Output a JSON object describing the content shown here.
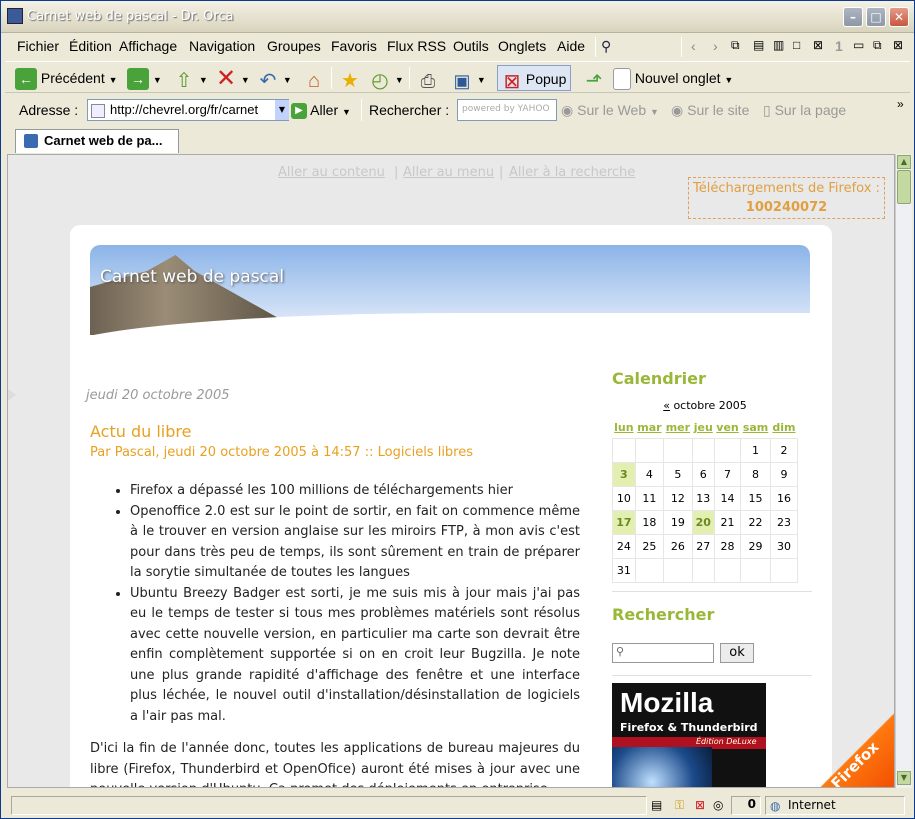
{
  "window": {
    "title": "Carnet web de pascal - Dr. Orca"
  },
  "menu": [
    "Fichier",
    "Édition",
    "Affichage",
    "Navigation",
    "Groupes",
    "Favoris",
    "Flux RSS",
    "Outils",
    "Onglets",
    "Aide"
  ],
  "tab_count": "1",
  "toolbar": {
    "back": "Précédent",
    "popup": "Popup",
    "new_tab": "Nouvel onglet"
  },
  "address": {
    "label": "Adresse :",
    "url": "http://chevrel.org/fr/carnet",
    "go": "Aller"
  },
  "search": {
    "label": "Rechercher :",
    "powered": "powered by YAHOO",
    "web": "Sur le Web",
    "site": "Sur le site",
    "page": "Sur la page"
  },
  "tab": {
    "title": "Carnet web de pa..."
  },
  "page": {
    "skip": [
      "Aller au contenu",
      "Aller au menu",
      "Aller à la recherche"
    ],
    "seps": [
      "|",
      "|"
    ],
    "downloads_label": "Téléchargements de Firefox :",
    "downloads_count": "100240072",
    "blog_title": "Carnet web de pascal",
    "date": "jeudi 20 octobre 2005",
    "post_title": "Actu du libre",
    "post_meta": "Par Pascal, jeudi 20 octobre 2005 à 14:57 :: Logiciels libres",
    "items": [
      "Firefox a dépassé les 100 millions de téléchargements hier",
      "Openoffice 2.0 est sur le point de sortir, en fait on commence même à le trouver en version anglaise sur les miroirs FTP, à mon avis c'est pour dans très peu de temps, ils sont sûrement en train de préparer la sorytie simultanée de toutes les langues",
      "Ubuntu Breezy Badger est sorti, je me suis mis à jour mais j'ai pas eu le temps de tester si tous mes problèmes matériels sont résolus avec cette nouvelle version, en particulier ma carte son devrait être enfin complètement supportée si on en croit leur Bugzilla. Je note une plus grande rapidité d'affichage des fenêtre et une interface plus léchée, le nouvel outil d'installation/désinstallation de logiciels a l'air pas mal."
    ],
    "paragraph": "D'ici la fin de l'année donc, toutes les applications de bureau majeures du libre (Firefox, Thunderbird et OpenOfice) auront été mises à jour avec une nouvelle version d'Ubuntu. Ça promet des déploiements en entreprise",
    "calendar_title": "Calendrier",
    "calendar_prev": "«",
    "calendar_month": "octobre 2005",
    "weekdays": [
      "lun",
      "mar",
      "mer",
      "jeu",
      "ven",
      "sam",
      "dim"
    ],
    "weeks": [
      [
        "",
        "",
        "",
        "",
        "",
        "1",
        "2"
      ],
      [
        "3",
        "4",
        "5",
        "6",
        "7",
        "8",
        "9"
      ],
      [
        "10",
        "11",
        "12",
        "13",
        "14",
        "15",
        "16"
      ],
      [
        "17",
        "18",
        "19",
        "20",
        "21",
        "22",
        "23"
      ],
      [
        "24",
        "25",
        "26",
        "27",
        "28",
        "29",
        "30"
      ],
      [
        "31",
        "",
        "",
        "",
        "",
        "",
        ""
      ]
    ],
    "highlighted": [
      "3",
      "17",
      "20"
    ],
    "search_title": "Rechercher",
    "search_button": "ok",
    "book_title": "Mozilla",
    "book_subtitle": "Firefox & Thunderbird",
    "book_edition": "Édition DeLuxe",
    "corner_badge": "Firefox !"
  },
  "statusbar": {
    "count": "0",
    "zone": "Internet"
  }
}
